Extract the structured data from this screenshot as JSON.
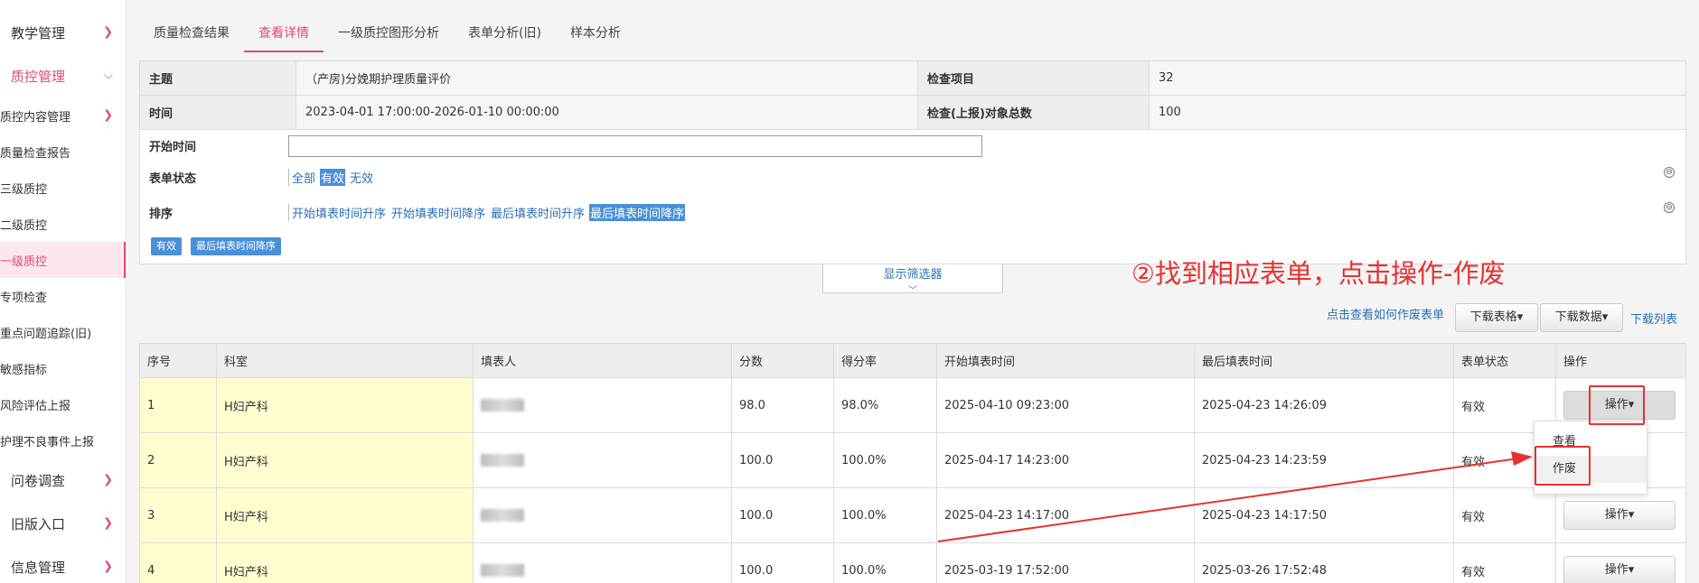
{
  "sidebar": {
    "groups": [
      {
        "label": "教学管理"
      },
      {
        "label": "质控管理"
      },
      {
        "label": "问卷调查"
      },
      {
        "label": "旧版入口"
      },
      {
        "label": "信息管理"
      }
    ],
    "items": [
      {
        "label": "质控内容管理"
      },
      {
        "label": "质量检查报告"
      },
      {
        "label": "三级质控"
      },
      {
        "label": "二级质控"
      },
      {
        "label": "一级质控"
      },
      {
        "label": "专项检查"
      },
      {
        "label": "重点问题追踪(旧)"
      },
      {
        "label": "敏感指标"
      },
      {
        "label": "风险评估上报"
      },
      {
        "label": "护理不良事件上报"
      }
    ]
  },
  "tabs": [
    {
      "label": "质量检查结果"
    },
    {
      "label": "查看详情"
    },
    {
      "label": "一级质控图形分析"
    },
    {
      "label": "表单分析(旧)"
    },
    {
      "label": "样本分析"
    }
  ],
  "info": {
    "subject_label": "主题",
    "subject_value": "（产房)分娩期护理质量评价",
    "items_label": "检查项目",
    "items_value": "32",
    "time_label": "时间",
    "time_value": "2023-04-01 17:00:00-2026-01-10 00:00:00",
    "total_label": "检查(上报)对象总数",
    "total_value": "100"
  },
  "filter": {
    "start_label": "开始时间",
    "start_value": "",
    "status_label": "表单状态",
    "status_options": [
      "全部",
      "有效",
      "无效"
    ],
    "sort_label": "排序",
    "sort_options": [
      "开始填表时间升序",
      "开始填表时间降序",
      "最后填表时间升序",
      "最后填表时间降序"
    ],
    "tags": [
      "有效",
      "最后填表时间降序"
    ],
    "collapse_icon": "⊖",
    "show_filter": "显示筛选器",
    "show_filter_icon": "﹀"
  },
  "annotation": "②找到相应表单，点击操作-作废",
  "toolbar": {
    "howto_link": "点击查看如何作废表单",
    "download_table": "下载表格▾",
    "download_data": "下载数据▾",
    "download_list": "下载列表"
  },
  "table": {
    "headers": [
      "序号",
      "科室",
      "填表人",
      "分数",
      "得分率",
      "开始填表时间",
      "最后填表时间",
      "表单状态",
      "操作"
    ],
    "rows": [
      {
        "no": "1",
        "dept": "H妇产科",
        "score": "98.0",
        "rate": "98.0%",
        "start": "2025-04-10 09:23:00",
        "last": "2025-04-23 14:26:09",
        "status": "有效",
        "op": "操作▾"
      },
      {
        "no": "2",
        "dept": "H妇产科",
        "score": "100.0",
        "rate": "100.0%",
        "start": "2025-04-17 14:23:00",
        "last": "2025-04-23 14:23:59",
        "status": "有效",
        "op": "操作▾"
      },
      {
        "no": "3",
        "dept": "H妇产科",
        "score": "100.0",
        "rate": "100.0%",
        "start": "2025-04-23 14:17:00",
        "last": "2025-04-23 14:17:50",
        "status": "有效",
        "op": "操作▾"
      },
      {
        "no": "4",
        "dept": "H妇产科",
        "score": "100.0",
        "rate": "100.0%",
        "start": "2025-03-19 17:52:00",
        "last": "2025-03-26 17:52:48",
        "status": "有效",
        "op": "操作▾"
      }
    ]
  },
  "dropdown": {
    "items": [
      "查看",
      "作废"
    ]
  },
  "colors": {
    "accent": "#e0477a",
    "link": "#2a6fb3",
    "annotation": "#e53232",
    "highlight_cell": "#fffdd0"
  }
}
